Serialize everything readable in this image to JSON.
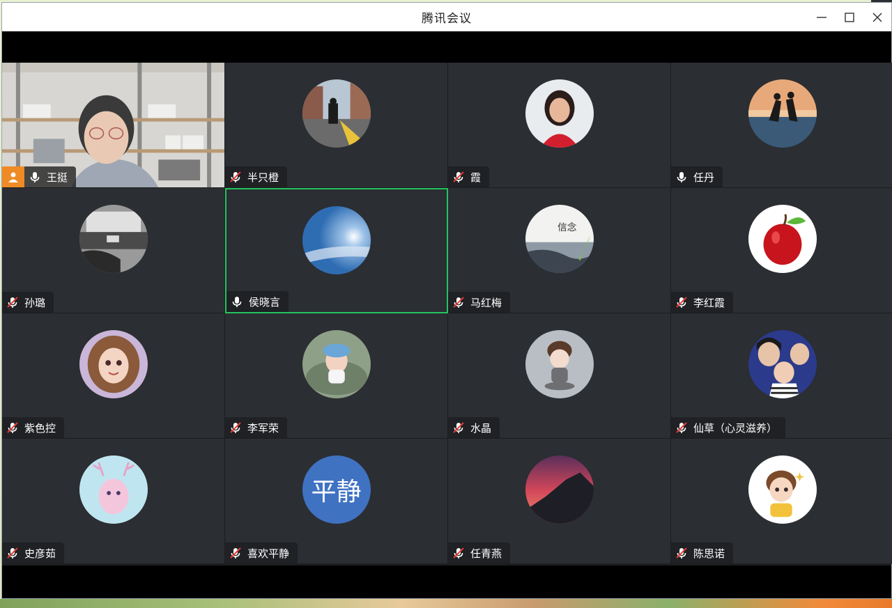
{
  "window": {
    "title": "腾讯会议",
    "controls": [
      "minimize-icon",
      "maximize-icon",
      "close-icon"
    ]
  },
  "participants": [
    {
      "name": "王挺",
      "mic": "on",
      "type": "video",
      "host": true
    },
    {
      "name": "半只橙",
      "mic": "muted",
      "type": "photo",
      "avatar": "street-photo"
    },
    {
      "name": "霞",
      "mic": "muted",
      "type": "photo",
      "avatar": "woman-portrait"
    },
    {
      "name": "任丹",
      "mic": "on",
      "type": "photo",
      "avatar": "couple-silhouette"
    },
    {
      "name": "孙璐",
      "mic": "muted",
      "type": "photo",
      "avatar": "bw-street"
    },
    {
      "name": "侯晓言",
      "mic": "on",
      "type": "photo",
      "avatar": "blue-sky",
      "active_speaker": true
    },
    {
      "name": "马红梅",
      "mic": "muted",
      "type": "photo",
      "avatar": "faith-poster",
      "avatar_text": "信念"
    },
    {
      "name": "李红霞",
      "mic": "muted",
      "type": "photo",
      "avatar": "red-apple"
    },
    {
      "name": "紫色控",
      "mic": "muted",
      "type": "photo",
      "avatar": "anime-girl"
    },
    {
      "name": "李军荣",
      "mic": "muted",
      "type": "photo",
      "avatar": "baby-photo"
    },
    {
      "name": "水晶",
      "mic": "muted",
      "type": "photo",
      "avatar": "cartoon-girl"
    },
    {
      "name": "仙草（心灵滋养）",
      "mic": "muted",
      "type": "photo",
      "avatar": "family-photo"
    },
    {
      "name": "史彦茹",
      "mic": "muted",
      "type": "photo",
      "avatar": "pastel-deer"
    },
    {
      "name": "喜欢平静",
      "mic": "muted",
      "type": "text",
      "avatar_text": "平静",
      "avatar_color": "#4072c2"
    },
    {
      "name": "任青燕",
      "mic": "muted",
      "type": "photo",
      "avatar": "sunset-mountain"
    },
    {
      "name": "陈思诺",
      "mic": "muted",
      "type": "photo",
      "avatar": "cartoon-boy"
    }
  ],
  "colors": {
    "active_border": "#22c55e",
    "host_badge": "#f08a24",
    "tile_bg": "#2b2e32"
  }
}
